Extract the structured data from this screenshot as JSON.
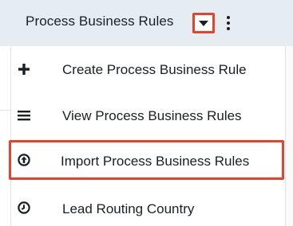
{
  "header": {
    "module_title": "Process Business Rules",
    "caret_icon": "caret-down-icon",
    "more_icon": "kebab-icon"
  },
  "menu": {
    "items": [
      {
        "label": "Create Process Business Rule",
        "icon": "plus-icon"
      },
      {
        "label": "View Process Business Rules",
        "icon": "list-icon"
      },
      {
        "label": "Import Process Business Rules",
        "icon": "import-arrow-up-icon",
        "highlighted": true
      },
      {
        "label": "Lead Routing Country",
        "icon": "clock-icon"
      }
    ]
  },
  "colors": {
    "header_bg": "#e6edf2",
    "highlight_border": "#e8412c",
    "text": "#1b1f23"
  }
}
